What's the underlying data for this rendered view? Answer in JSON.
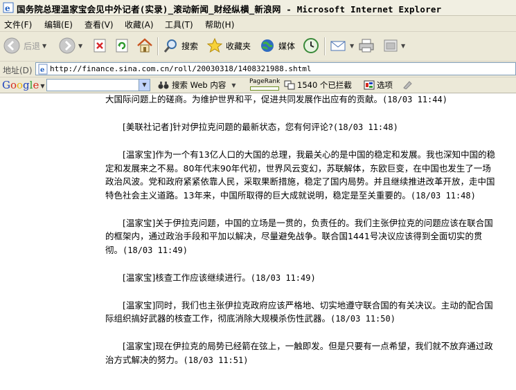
{
  "window": {
    "title": "国务院总理温家宝会见中外记者(实录)_滚动新闻_财经纵横_新浪网 - Microsoft Internet Explorer"
  },
  "menubar": {
    "items": [
      "文件(F)",
      "编辑(E)",
      "查看(V)",
      "收藏(A)",
      "工具(T)",
      "帮助(H)"
    ]
  },
  "toolbar": {
    "back_label": "后退",
    "search_label": "搜索",
    "favorites_label": "收藏夹",
    "media_label": "媒体"
  },
  "address": {
    "label": "地址(D)",
    "url": "http://finance.sina.com.cn/roll/20030318/1408321988.shtml"
  },
  "google": {
    "logo": "Google",
    "search_value": "",
    "search_web_label": "搜索 Web 内容",
    "pagerank_label": "PageRank",
    "popup_blocked": "1540 个已拦截",
    "options_label": "选项"
  },
  "article": {
    "paragraphs": [
      {
        "text": "大国际问题上的磋商。为维护世界和平，促进共同发展作出应有的贡献。",
        "time": "(18/03 11:44)",
        "first": true
      },
      {
        "text": "[美联社记者]针对伊拉克问题的最新状态，您有何评论?",
        "time": "(18/03 11:48)"
      },
      {
        "text": "[温家宝]作为一个有13亿人口的大国的总理，我最关心的是中国的稳定和发展。我也深知中国的稳定和发展来之不易。80年代末90年代初，世界风云变幻，苏联解体，东欧巨变，在中国也发生了一场政治风波。党和政府紧紧依靠人民，采取果断措施，稳定了国内局势。并且继续推进改革开放，走中国特色社会主义道路。13年来，中国所取得的巨大成就说明，稳定是至关重要的。",
        "time": "(18/03 11:48)"
      },
      {
        "text": "[温家宝]关于伊拉克问题，中国的立场是一贯的，负责任的。我们主张伊拉克的问题应该在联合国的框架内，通过政治手段和平加以解决，尽量避免战争。联合国1441号决议应该得到全面切实的贯彻。",
        "time": "(18/03 11:49)"
      },
      {
        "text": "[温家宝]核查工作应该继续进行。",
        "time": "(18/03 11:49)"
      },
      {
        "text": "[温家宝]同时，我们也主张伊拉克政府应该严格地、切实地遵守联合国的有关决议。主动的配合国际组织搞好武器的核查工作，彻底消除大规模杀伤性武器。",
        "time": "(18/03 11:50)"
      },
      {
        "text": "[温家宝]现在伊拉克的局势已经箭在弦上，一触即发。但是只要有一点希望，我们就不放弃通过政治方式解决的努力。",
        "time": "(18/03 11:51)"
      }
    ]
  }
}
